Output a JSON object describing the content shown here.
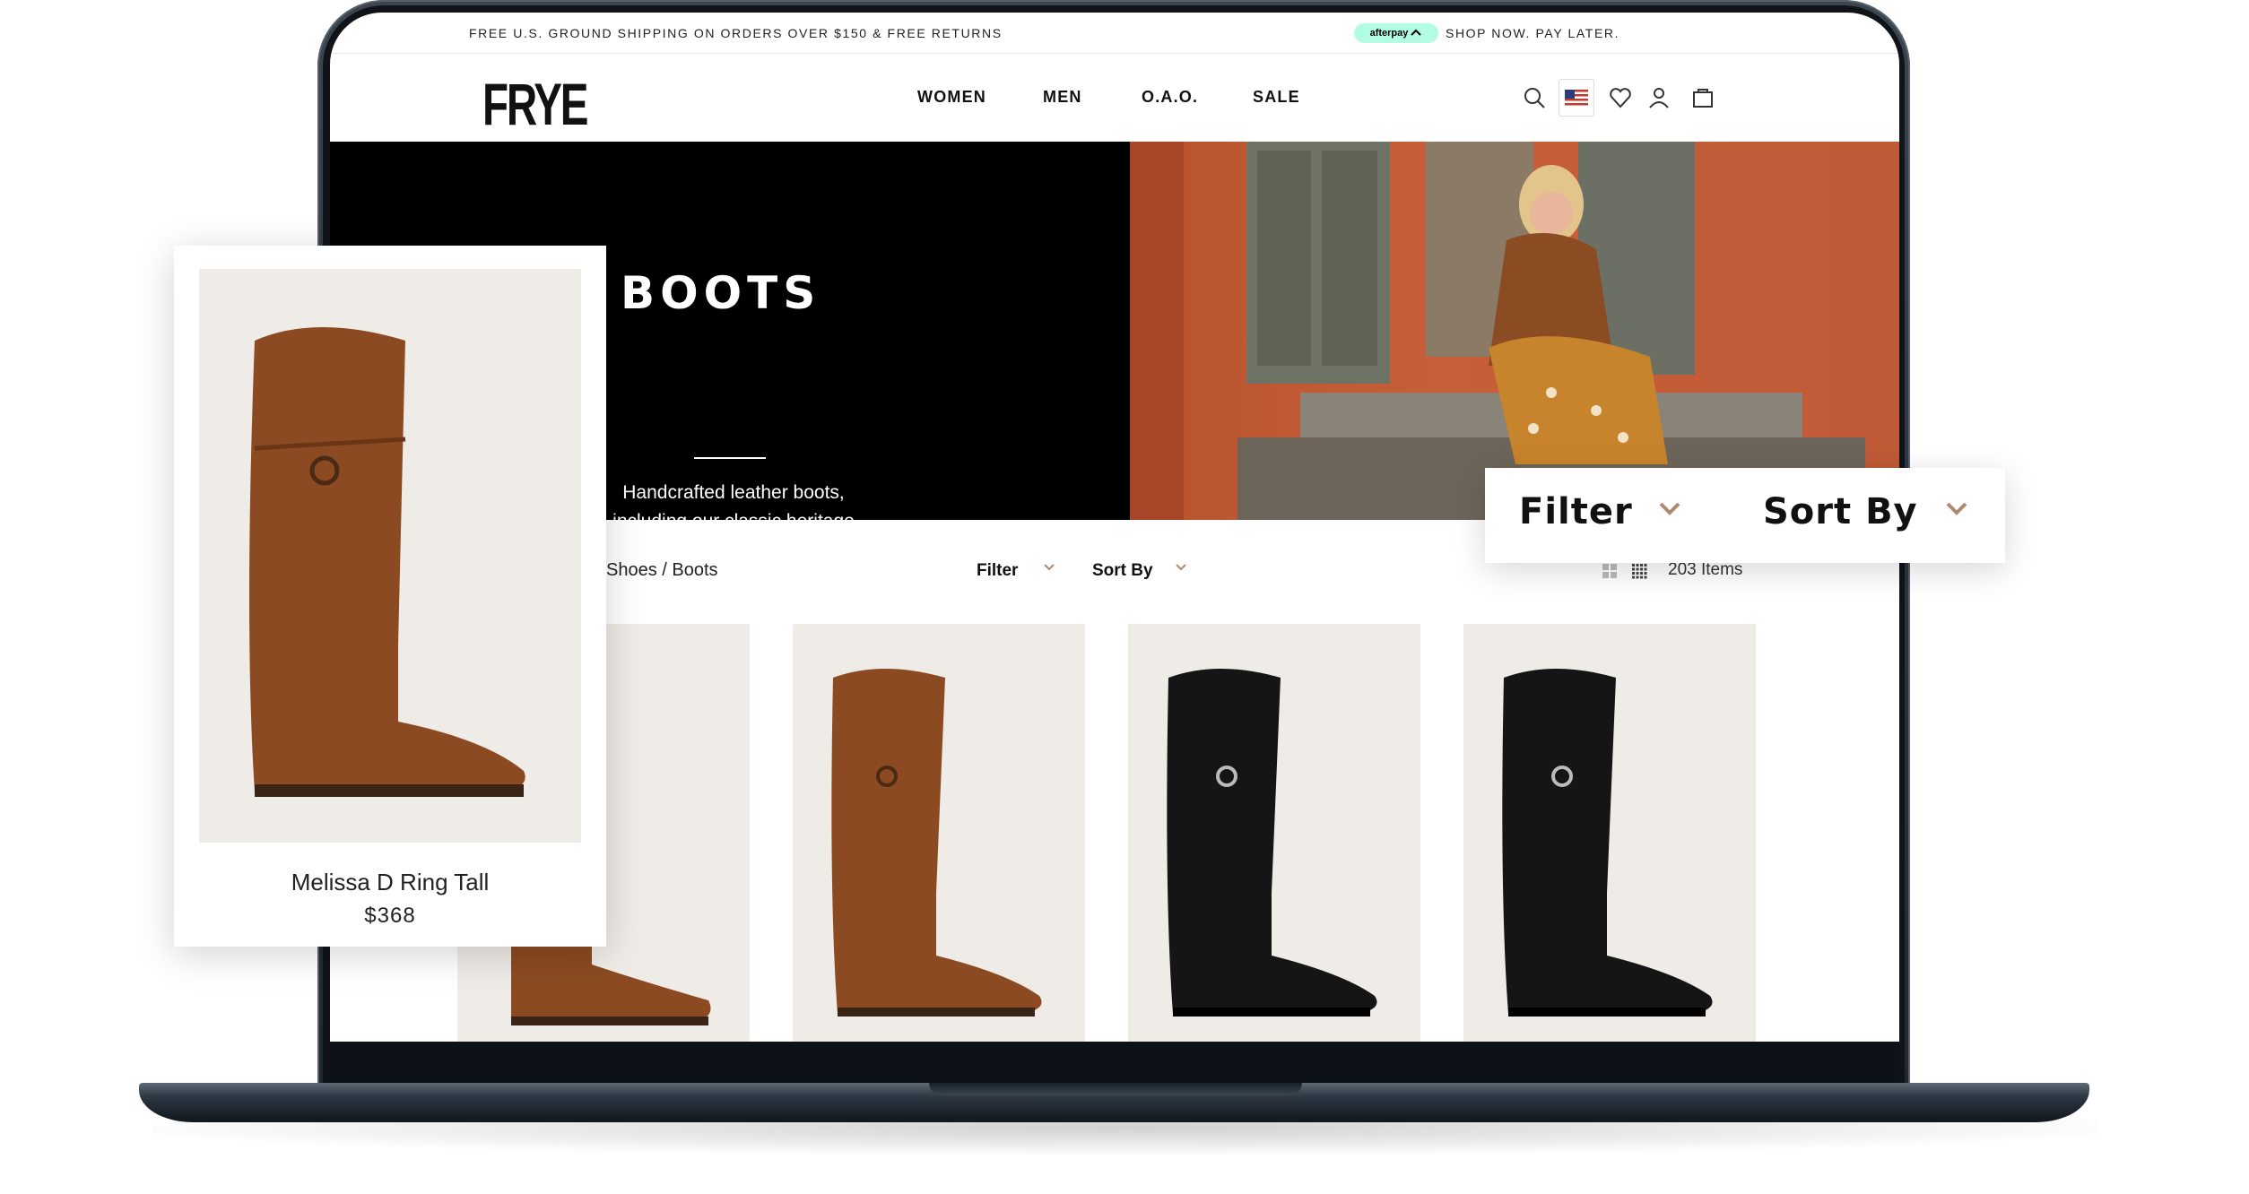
{
  "promo": {
    "shipping_text": "FREE U.S. GROUND SHIPPING ON ORDERS OVER $150 & FREE RETURNS",
    "afterpay_badge": "afterpay",
    "afterpay_text": "SHOP NOW. PAY LATER."
  },
  "header": {
    "logo": "FRYE",
    "nav": [
      "WOMEN",
      "MEN",
      "O.A.O.",
      "SALE"
    ],
    "icons": [
      "search-icon",
      "us-flag-icon",
      "heart-icon",
      "account-icon",
      "bag-icon"
    ]
  },
  "hero": {
    "title": "BOOTS",
    "description": "Handcrafted leather boots, including our classic heritage styles."
  },
  "toolbar": {
    "breadcrumb": "Shoes / Boots",
    "filter_label": "Filter",
    "sort_label": "Sort By",
    "item_count": "203 Items"
  },
  "products": [
    {
      "color": "brown"
    },
    {
      "color": "brown"
    },
    {
      "color": "black"
    },
    {
      "color": "black"
    }
  ],
  "featured_product": {
    "name": "Melissa D Ring Tall",
    "price": "$368"
  },
  "filter_card": {
    "filter_label": "Filter",
    "sort_label": "Sort By"
  },
  "colors": {
    "accent_chevron": "#b08a70",
    "hero_bg": "#000000",
    "tile_bg": "#efebe6",
    "afterpay_mint": "#b2fce4"
  }
}
